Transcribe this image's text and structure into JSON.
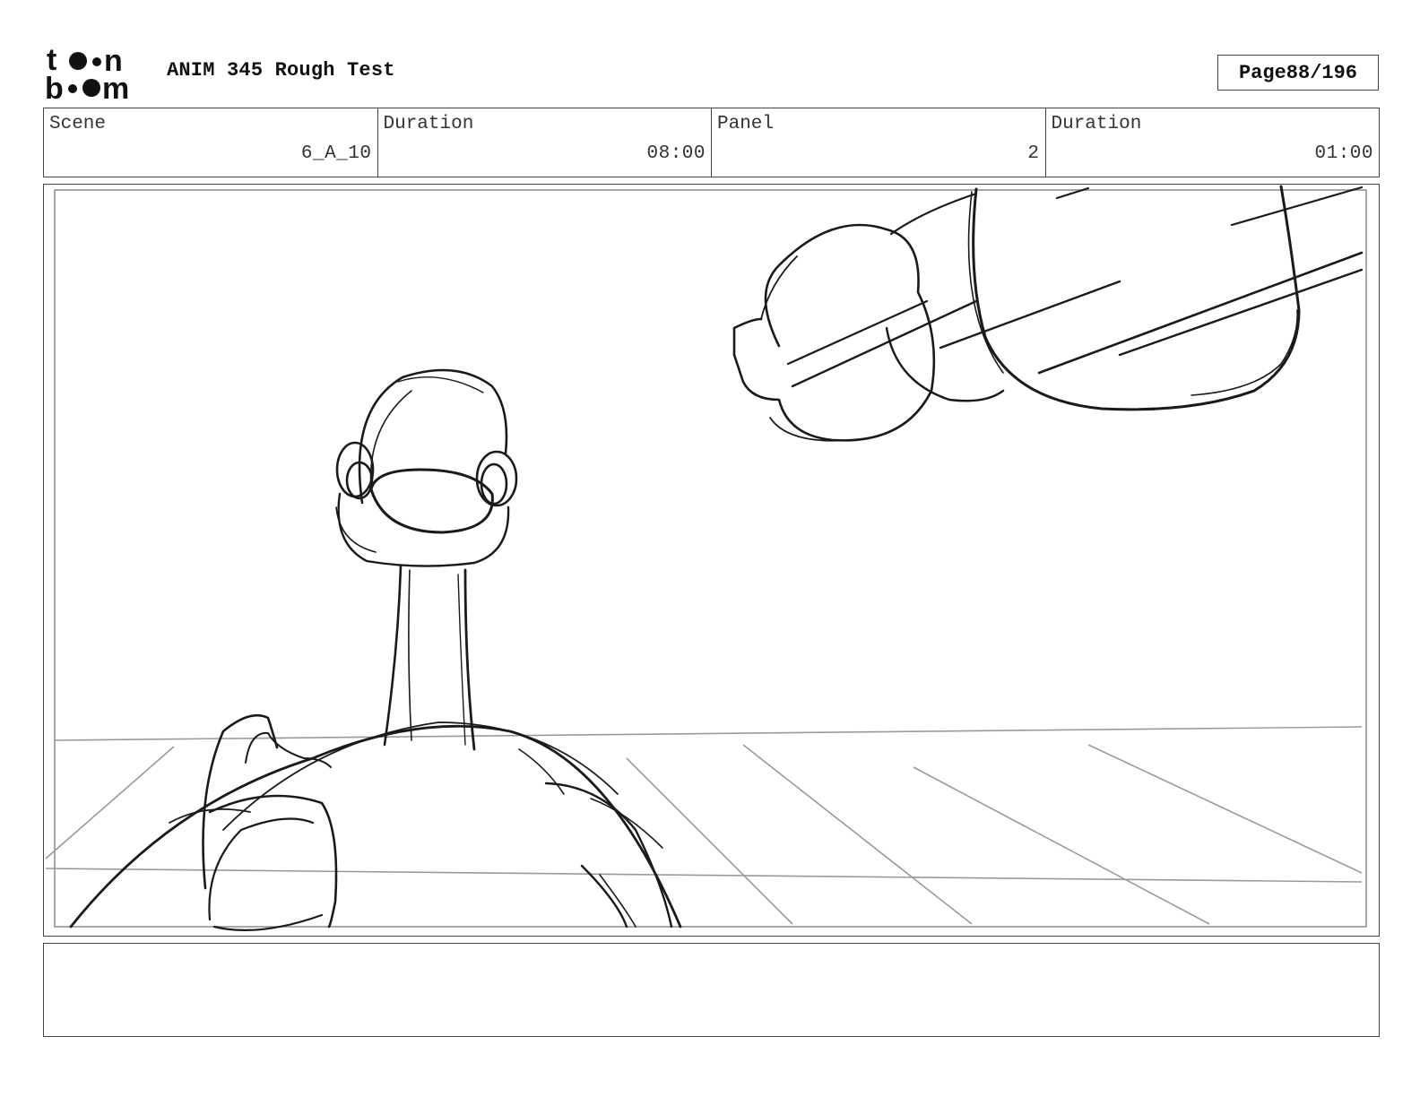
{
  "header": {
    "logo_text_top": "toon",
    "logo_text_bottom": "boom",
    "title": "ANIM 345 Rough Test",
    "page_label": "Page",
    "page_number": "88/196"
  },
  "info": {
    "scene_label": "Scene",
    "scene_value": "6_A_10",
    "scene_duration_label": "Duration",
    "scene_duration_value": "08:00",
    "panel_label": "Panel",
    "panel_value": "2",
    "panel_duration_label": "Duration",
    "panel_duration_value": "01:00"
  },
  "notes": {
    "text": ""
  },
  "colors": {
    "ink": "#1a1a1a",
    "guide": "#9a9a9a",
    "border": "#444444"
  }
}
